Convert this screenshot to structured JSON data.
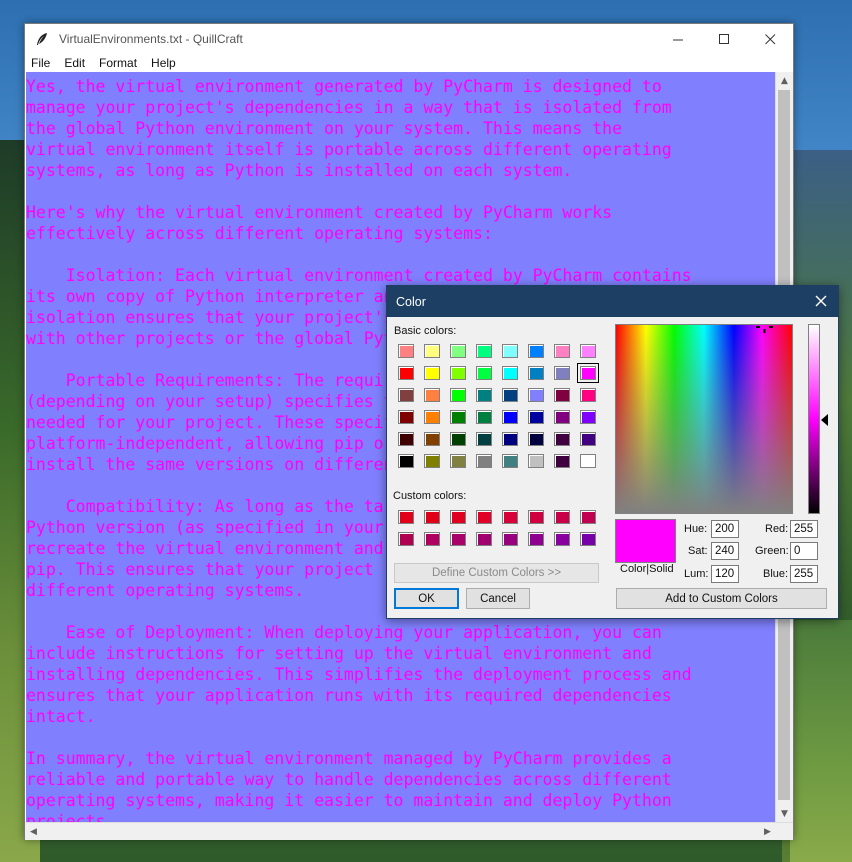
{
  "window": {
    "title": "VirtualEnvironments.txt - QuillCraft",
    "controls": {
      "minimize": "—",
      "maximize": "☐",
      "close": "✕"
    }
  },
  "menu": [
    "File",
    "Edit",
    "Format",
    "Help"
  ],
  "editor": {
    "background": "#8080ff",
    "text_color": "#ff00ff",
    "lines": [
      "Yes, the virtual environment generated by PyCharm is designed to",
      "manage your project's dependencies in a way that is isolated from",
      "the global Python environment on your system. This means the",
      "virtual environment itself is portable across different operating",
      "systems, as long as Python is installed on each system.",
      "",
      "Here's why the virtual environment created by PyCharm works",
      "effectively across different operating systems:",
      "",
      "    Isolation: Each virtual environment created by PyCharm contains",
      "its own copy of Python interpreter and installed packages. This",
      "isolation ensures that your project's dependencies do not conflict",
      "with other projects or the global Python installation.",
      "",
      "    Portable Requirements: The requirements.txt or Pipfile",
      "(depending on your setup) specifies the exact package versions",
      "needed for your project. These specifications are generally",
      "platform-independent, allowing pip or other package managers to",
      "install the same versions on different operating systems.",
      "",
      "    Compatibility: As long as the target system has a compatible",
      "Python version (as specified in your project), you can easily",
      "recreate the virtual environment and install dependencies using",
      "pip. This ensures that your project runs consistently across",
      "different operating systems.",
      "",
      "    Ease of Deployment: When deploying your application, you can",
      "include instructions for setting up the virtual environment and",
      "installing dependencies. This simplifies the deployment process and",
      "ensures that your application runs with its required dependencies",
      "intact.",
      "",
      "In summary, the virtual environment managed by PyCharm provides a",
      "reliable and portable way to handle dependencies across different",
      "operating systems, making it easier to maintain and deploy Python",
      "projects."
    ]
  },
  "color_dialog": {
    "title": "Color",
    "basic_colors_label": "Basic colors:",
    "custom_colors_label": "Custom colors:",
    "basic_colors": [
      [
        "#ff8080",
        "#ffff80",
        "#80ff80",
        "#00ff80",
        "#80ffff",
        "#0080ff",
        "#ff80c0",
        "#ff80ff"
      ],
      [
        "#ff0000",
        "#ffff00",
        "#80ff00",
        "#00ff40",
        "#00ffff",
        "#0080c0",
        "#8080c0",
        "#ff00ff"
      ],
      [
        "#804040",
        "#ff8040",
        "#00ff00",
        "#008080",
        "#004080",
        "#8080ff",
        "#800040",
        "#ff0080"
      ],
      [
        "#800000",
        "#ff8000",
        "#008000",
        "#008040",
        "#0000ff",
        "#0000a0",
        "#800080",
        "#8000ff"
      ],
      [
        "#400000",
        "#804000",
        "#004000",
        "#004040",
        "#000080",
        "#000040",
        "#400040",
        "#400080"
      ],
      [
        "#000000",
        "#808000",
        "#808040",
        "#808080",
        "#408080",
        "#c0c0c0",
        "#400040",
        "#ffffff"
      ]
    ],
    "custom_colors": [
      [
        "#e0001a",
        "#e00018",
        "#e00020",
        "#e00028",
        "#d80038",
        "#d00040",
        "#c80048",
        "#c00050"
      ],
      [
        "#b00050",
        "#b00060",
        "#a80068",
        "#a00070",
        "#980080",
        "#900090",
        "#8800a0",
        "#7800a8"
      ]
    ],
    "define_custom_label": "Define Custom Colors >>",
    "ok_label": "OK",
    "cancel_label": "Cancel",
    "color_solid_label": "Color|Solid",
    "add_custom_label": "Add to Custom Colors",
    "hue_label": "Hue:",
    "hue": "200",
    "sat_label": "Sat:",
    "sat": "240",
    "lum_label": "Lum:",
    "lum": "120",
    "red_label": "Red:",
    "red": "255",
    "green_label": "Green:",
    "green": "0",
    "blue_label": "Blue:",
    "blue": "255",
    "selected_color": "#ff00ff"
  }
}
